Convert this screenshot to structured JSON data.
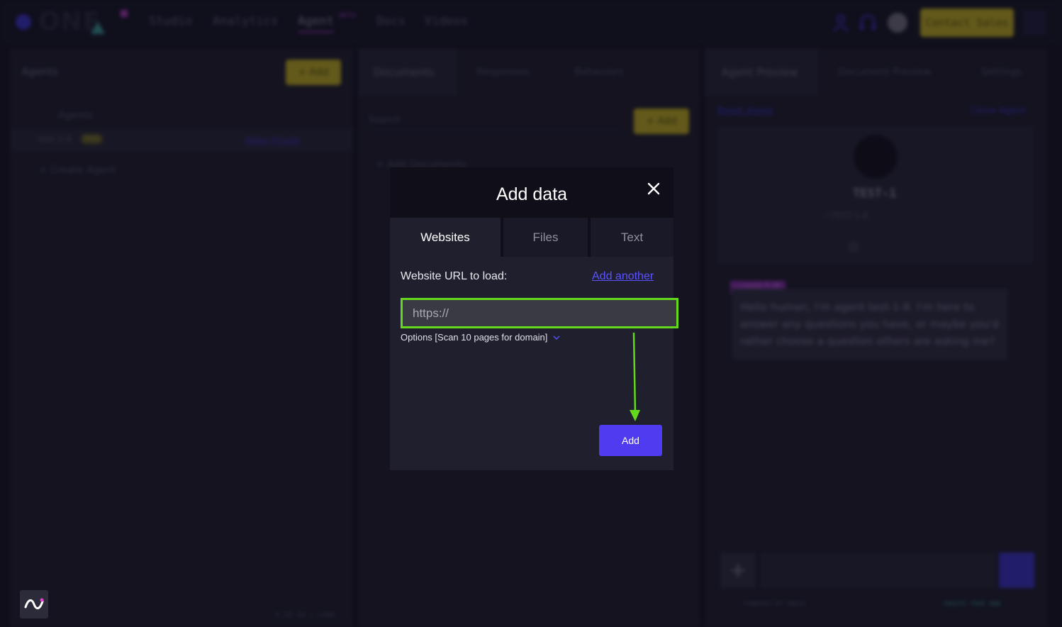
{
  "top_nav": {
    "logo_text": "ONE",
    "items": [
      "Studio",
      "Analytics",
      "Agent",
      "Docs",
      "Videos"
    ],
    "beta_badge": "BETA",
    "contact_label": "Contact Sales"
  },
  "left_panel": {
    "title": "Agents",
    "add_label": "+ Add",
    "folder_label": "Agents",
    "agent_name": "test-1-8",
    "agent_badge": "Free",
    "agent_link": "Make Private",
    "create_label": "+ Create Agent",
    "version": "4.25.18 / v290"
  },
  "middle_panel": {
    "tabs": [
      "Documents",
      "Responses",
      "Behaviors"
    ],
    "search_placeholder": "Search",
    "add_label": "+ Add",
    "add_documents_label": "+ Add Documents"
  },
  "right_panel": {
    "tabs": [
      "Agent Preview",
      "Document Preview",
      "Settings"
    ],
    "reset_link": "Reset Agent",
    "clone_link": "Clone Agent",
    "agent_title": "TEST-1",
    "agent_sub": "~TEST-1-8",
    "chat_tag": "~test-1-8",
    "chat_message": "Hello human, I'm agent test-1-8. I'm here to answer any questions you have, or maybe you'd rather choose a question others are asking me?",
    "powered_by": "POWERED BY ONEAI",
    "create_own": "CREATE YOUR OWN"
  },
  "modal": {
    "title": "Add data",
    "tabs": [
      "Websites",
      "Files",
      "Text"
    ],
    "active_tab": "Websites",
    "url_label": "Website URL to load:",
    "add_another": "Add another",
    "url_placeholder": "https://",
    "url_value": "",
    "options_label": "Options [Scan 10 pages for domain]",
    "add_button": "Add"
  },
  "colors": {
    "highlight": "#63d81c",
    "primary": "#4f3cf0",
    "link": "#5b52ff",
    "accent_yellow": "#d6c21c"
  }
}
